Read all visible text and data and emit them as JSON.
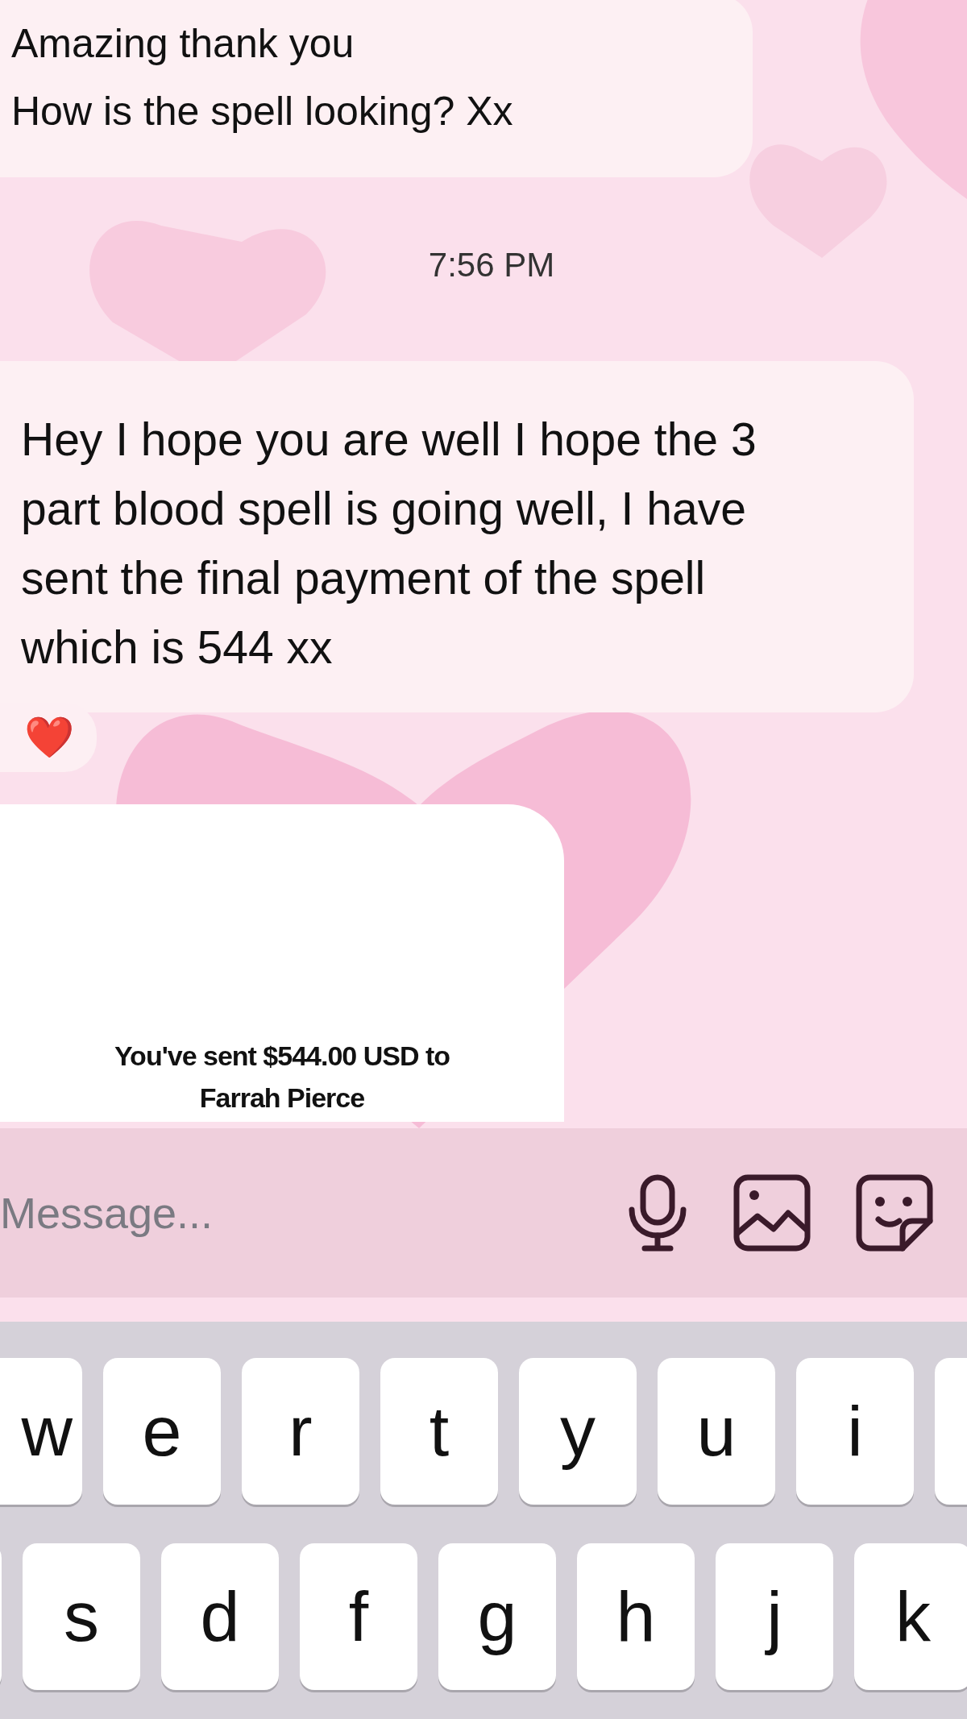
{
  "messages": [
    {
      "kind": "text",
      "lines": [
        "Amazing thank you",
        "How is the spell looking? Xx"
      ]
    },
    {
      "kind": "time",
      "text": "7:56 PM"
    },
    {
      "kind": "text",
      "lines": [
        "Hey I hope you are well I hope the 3 part blood spell is going well, I have sent the final payment of the spell which is 544 xx"
      ],
      "reaction": "❤️"
    },
    {
      "kind": "payment",
      "lines": [
        "You've sent $544.00 USD to",
        "Farrah Pierce"
      ]
    }
  ],
  "composer": {
    "placeholder": "Message..."
  },
  "keyboard": {
    "rows": [
      [
        "w",
        "e",
        "r",
        "t",
        "y",
        "u",
        "i",
        ""
      ],
      [
        "",
        "s",
        "d",
        "f",
        "g",
        "h",
        "j",
        "k"
      ]
    ]
  }
}
